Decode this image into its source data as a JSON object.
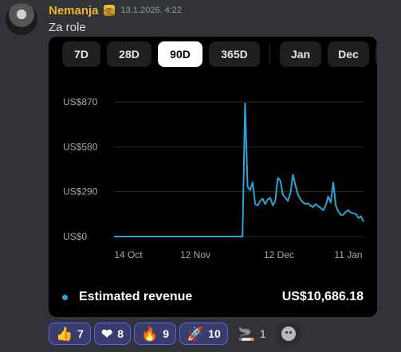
{
  "message": {
    "username": "Nemanja",
    "badge_icon": "pharaoh-icon",
    "timestamp": "13.1.2026. 4:22",
    "text": "Za role"
  },
  "tabs": [
    "7D",
    "28D",
    "90D",
    "365D",
    "Jan",
    "Dec",
    ""
  ],
  "active_tab": "90D",
  "chart_data": {
    "type": "line",
    "y_ticks": [
      "US$870",
      "US$580",
      "US$290",
      "US$0"
    ],
    "x_ticks": [
      "14 Oct",
      "12 Nov",
      "12 Dec",
      "11 Jan"
    ],
    "ylim": [
      0,
      870
    ],
    "line_color": "#27a6d6",
    "series": [
      {
        "values": [
          0,
          0,
          0,
          0,
          0,
          0,
          0,
          0,
          0,
          0,
          0,
          0,
          0,
          0,
          0,
          0,
          0,
          0,
          0,
          0,
          0,
          0,
          0,
          0,
          0,
          0,
          0,
          0,
          0,
          0,
          0,
          0,
          0,
          0,
          0,
          0,
          0,
          0,
          0,
          0,
          0,
          0,
          0,
          0,
          0,
          0,
          0,
          0,
          0,
          0,
          0,
          0,
          860,
          320,
          300,
          350,
          210,
          200,
          230,
          245,
          210,
          240,
          250,
          200,
          230,
          380,
          360,
          270,
          250,
          230,
          280,
          400,
          330,
          270,
          240,
          220,
          210,
          215,
          200,
          190,
          210,
          195,
          185,
          170,
          200,
          260,
          220,
          350,
          200,
          160,
          140,
          140,
          160,
          170,
          155,
          150,
          145,
          120,
          130,
          95
        ]
      }
    ]
  },
  "legend": {
    "label": "Estimated revenue",
    "total": "US$10,686.18",
    "dot_color": "#27a6d6"
  },
  "reactions": [
    {
      "emoji": "👍",
      "name": "thumbs-up-icon",
      "count": "7",
      "highlighted": true
    },
    {
      "emoji": "❤",
      "name": "heart-icon",
      "count": "8",
      "highlighted": true
    },
    {
      "emoji": "🔥",
      "name": "fire-icon",
      "count": "9",
      "highlighted": true
    },
    {
      "emoji": "🚀",
      "name": "rocket-icon",
      "count": "10",
      "highlighted": true
    },
    {
      "emoji": "🚬",
      "name": "cigarette-icon",
      "count": "1",
      "highlighted": false
    }
  ]
}
